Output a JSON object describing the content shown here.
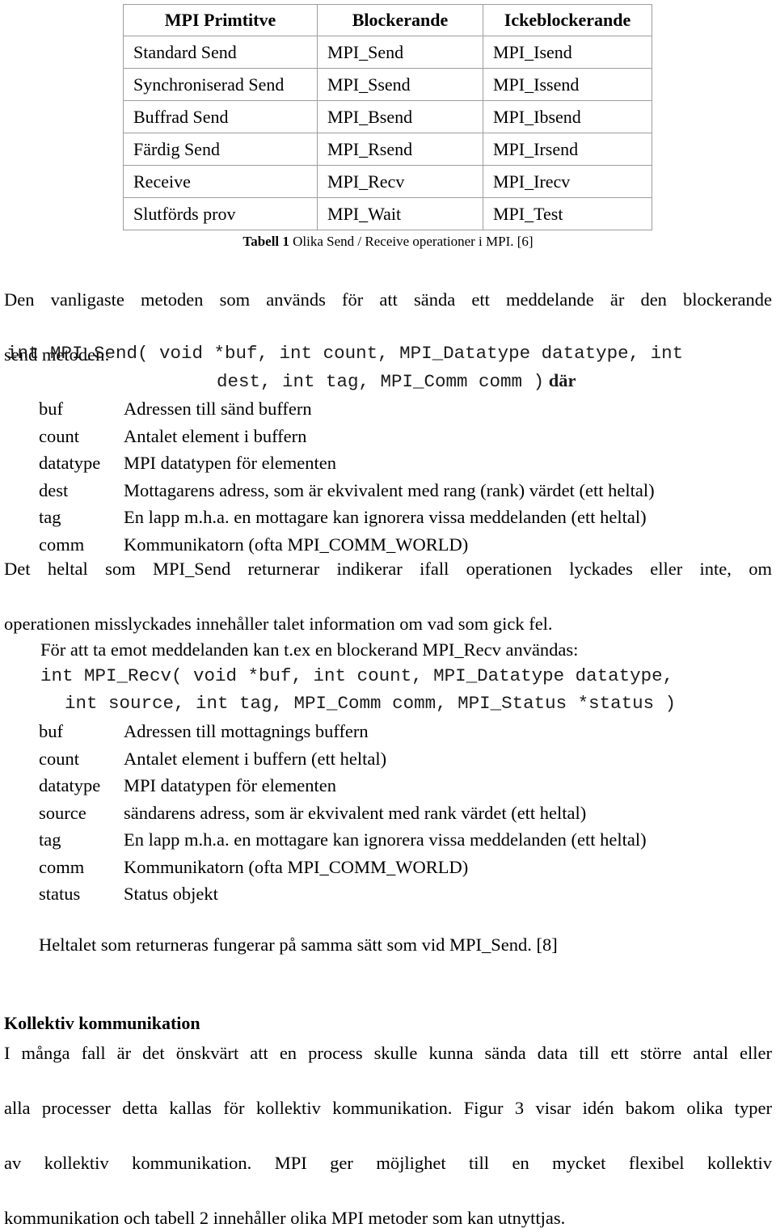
{
  "table": {
    "headers": [
      "MPI Primtitve",
      "Blockerande",
      "Ickeblockerande"
    ],
    "rows": [
      [
        "Standard Send",
        "MPI_Send",
        "MPI_Isend"
      ],
      [
        "Synchroniserad Send",
        "MPI_Ssend",
        "MPI_Issend"
      ],
      [
        "Buffrad Send",
        "MPI_Bsend",
        "MPI_Ibsend"
      ],
      [
        "Färdig Send",
        "MPI_Rsend",
        "MPI_Irsend"
      ],
      [
        "Receive",
        "MPI_Recv",
        "MPI_Irecv"
      ],
      [
        "Slutförds prov",
        "MPI_Wait",
        "MPI_Test"
      ]
    ],
    "caption_label": "Tabell 1",
    "caption_text": " Olika Send / Receive operationer i MPI. [6]"
  },
  "intro": {
    "line1": "Den vanligaste metoden som används för att sända ett meddelande är den blockerande",
    "line2": "send metoden:"
  },
  "send_signature": {
    "line1": "int MPI_Send( void *buf, int count, MPI_Datatype datatype, int",
    "line2": "dest, int tag, MPI_Comm comm )",
    "line2_suffix": " där"
  },
  "send_params": [
    {
      "key": "buf",
      "value": "Adressen till sänd buffern"
    },
    {
      "key": "count",
      "value": "Antalet element i buffern"
    },
    {
      "key": "datatype",
      "value": "MPI datatypen för elementen"
    },
    {
      "key": "dest",
      "value": "Mottagarens adress, som är ekvivalent med rang (rank) värdet (ett heltal)"
    },
    {
      "key": "tag",
      "value": "En lapp m.h.a. en mottagare kan ignorera vissa meddelanden (ett heltal)"
    },
    {
      "key": "comm",
      "value": "Kommunikatorn (ofta MPI_COMM_WORLD)"
    }
  ],
  "return_para": {
    "line1": "Det heltal som MPI_Send returnerar indikerar ifall operationen lyckades eller inte, om",
    "line2": "operationen misslyckades innehåller talet information om vad som gick fel."
  },
  "recv_lead": "För att ta emot meddelanden kan t.ex en blockerand MPI_Recv användas:",
  "recv_signature": {
    "line1": "int MPI_Recv( void *buf, int count, MPI_Datatype datatype,",
    "line2": "int source, int tag, MPI_Comm comm, MPI_Status *status )"
  },
  "recv_params": [
    {
      "key": "buf",
      "value": "Adressen till mottagnings buffern"
    },
    {
      "key": "count",
      "value": "Antalet element i buffern (ett heltal)"
    },
    {
      "key": "datatype",
      "value": "MPI datatypen för elementen"
    },
    {
      "key": "source",
      "value": "sändarens adress, som är ekvivalent med rank värdet (ett heltal)"
    },
    {
      "key": "tag",
      "value": "En lapp m.h.a. en mottagare kan ignorera vissa meddelanden (ett heltal)"
    },
    {
      "key": "comm",
      "value": "Kommunikatorn (ofta MPI_COMM_WORLD)"
    },
    {
      "key": "status",
      "value": "Status objekt"
    }
  ],
  "heltalet_para": "Heltalet som returneras fungerar på samma sätt som vid MPI_Send. [8]",
  "section": {
    "heading": "Kollektiv kommunikation",
    "line1": "I många fall är det önskvärt att en process skulle kunna sända data till ett större antal eller",
    "line2": "alla processer detta kallas för kollektiv kommunikation. Figur 3 visar idén bakom olika typer",
    "line3": "av kollektiv kommunikation. MPI ger möjlighet till en mycket flexibel kollektiv",
    "line4": "kommunikation och tabell 2 innehåller olika MPI metoder som kan utnyttjas."
  }
}
